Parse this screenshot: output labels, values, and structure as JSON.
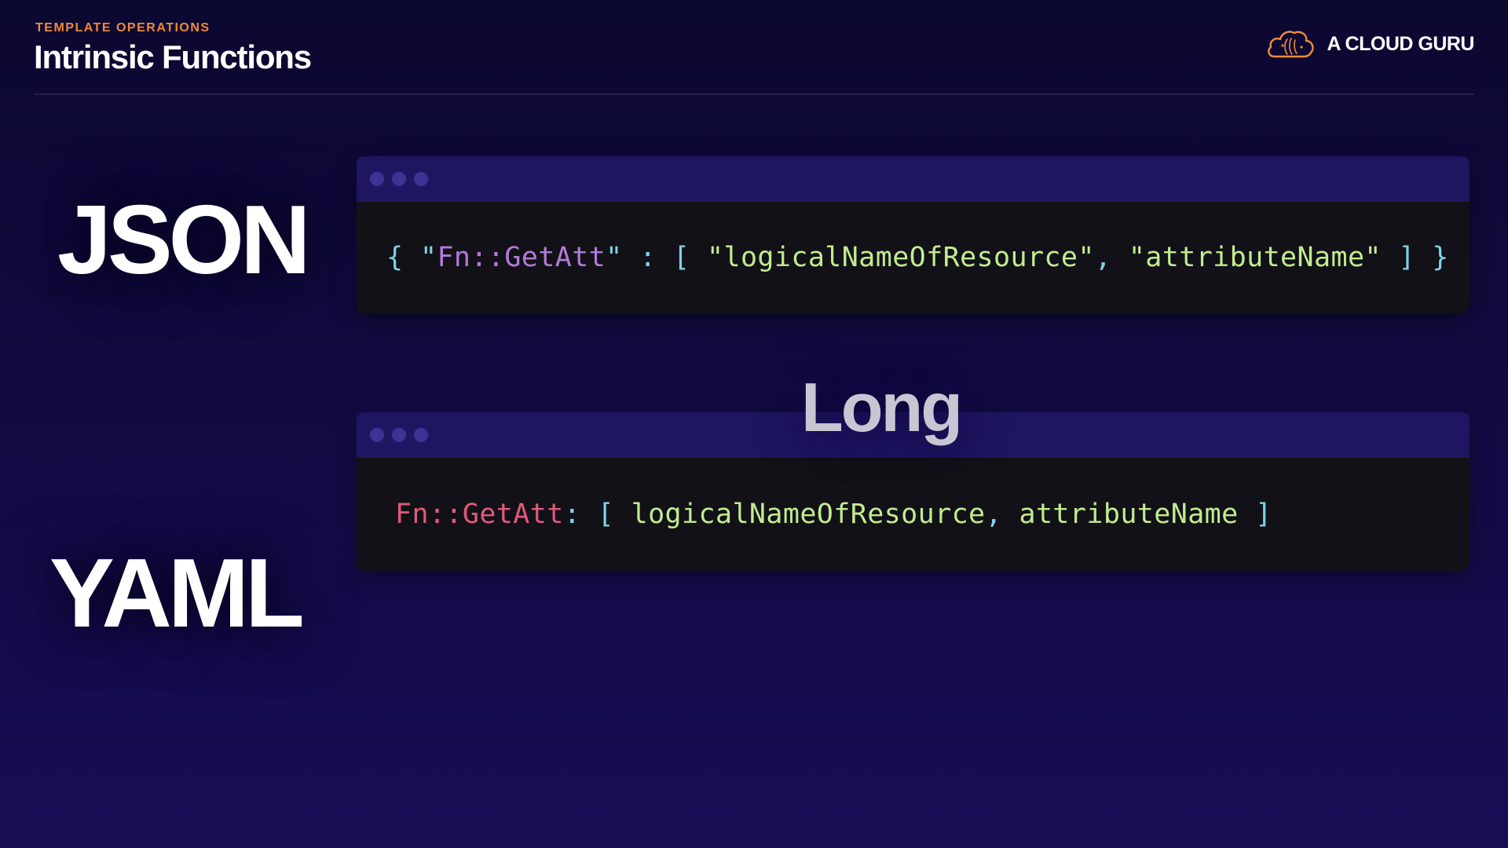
{
  "header": {
    "eyebrow": "TEMPLATE OPERATIONS",
    "title": "Intrinsic Functions"
  },
  "brand": {
    "name": "A CLOUD GURU",
    "logo_icon": "cloud-logo-icon",
    "logo_color": "#ef8a3b"
  },
  "labels": {
    "json": "JSON",
    "yaml": "YAML",
    "long": "Long"
  },
  "json_code": {
    "open_brace": "{ ",
    "fn_quote_open": "\"",
    "fn_name": "Fn::GetAtt",
    "fn_quote_close": "\"",
    "colon_bracket": " : [ ",
    "arg1": "\"logicalNameOfResource\"",
    "comma": ", ",
    "arg2": "\"attributeName\"",
    "close": " ] }"
  },
  "yaml_code": {
    "fn_name": "Fn::GetAtt",
    "colon_bracket": ": [ ",
    "arg1": "logicalNameOfResource",
    "comma": ", ",
    "arg2": "attributeName",
    "close": " ]"
  },
  "colors": {
    "eyebrow": "#ef8a3b",
    "punctuation": "#7fd3e8",
    "json_function": "#b27ad9",
    "string": "#c2eb8f",
    "yaml_function": "#e0597b",
    "window_bar": "#1e1660",
    "code_background": "#121117"
  }
}
